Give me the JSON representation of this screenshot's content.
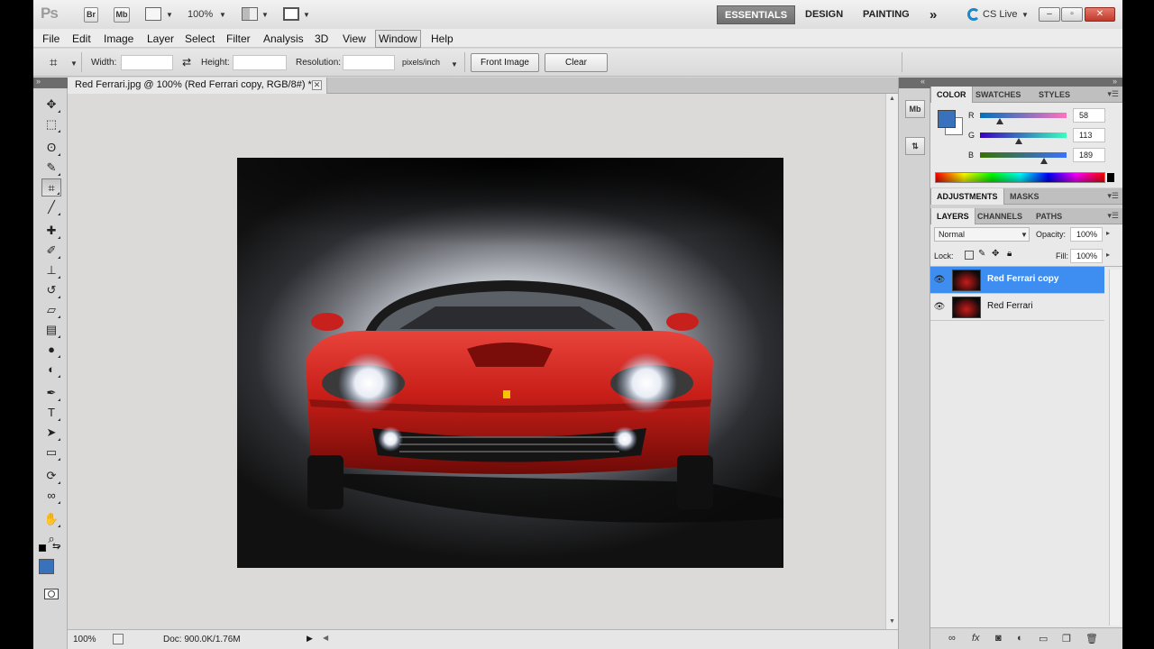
{
  "app": {
    "logo": "Ps",
    "bridge_label": "Br",
    "minibridge_label": "Mb",
    "zoom_value": "100%",
    "workspaces": [
      "ESSENTIALS",
      "DESIGN",
      "PAINTING"
    ],
    "more_workspaces": "»",
    "cslive": "CS Live",
    "window_controls": {
      "minimize": "–",
      "restore": "▫",
      "close": "✕"
    }
  },
  "menu": [
    "File",
    "Edit",
    "Image",
    "Layer",
    "Select",
    "Filter",
    "Analysis",
    "3D",
    "View",
    "Window",
    "Help"
  ],
  "options": {
    "width_label": "Width:",
    "height_label": "Height:",
    "swap_icon": "⇄",
    "resolution_label": "Resolution:",
    "units": "pixels/inch",
    "front_image": "Front Image",
    "clear": "Clear"
  },
  "document": {
    "tab_title": "Red Ferrari.jpg @ 100% (Red Ferrari copy, RGB/8#) *",
    "close": "✕",
    "status_zoom": "100%",
    "status_doc": "Doc: 900.0K/1.76M"
  },
  "tools": [
    {
      "name": "move-tool",
      "glyph": "✥",
      "selected": false
    },
    {
      "name": "marquee-tool",
      "glyph": "⬚",
      "selected": false
    },
    {
      "name": "lasso-tool",
      "glyph": "ʘ",
      "selected": false
    },
    {
      "name": "quick-selection-tool",
      "glyph": "✎",
      "selected": false
    },
    {
      "name": "crop-tool",
      "glyph": "⌗",
      "selected": true
    },
    {
      "name": "eyedropper-tool",
      "glyph": "╱",
      "selected": false
    },
    {
      "name": "healing-brush-tool",
      "glyph": "✚",
      "selected": false
    },
    {
      "name": "brush-tool",
      "glyph": "✐",
      "selected": false
    },
    {
      "name": "clone-stamp-tool",
      "glyph": "⊥",
      "selected": false
    },
    {
      "name": "history-brush-tool",
      "glyph": "↺",
      "selected": false
    },
    {
      "name": "eraser-tool",
      "glyph": "▱",
      "selected": false
    },
    {
      "name": "gradient-tool",
      "glyph": "▤",
      "selected": false
    },
    {
      "name": "blur-tool",
      "glyph": "●",
      "selected": false
    },
    {
      "name": "dodge-tool",
      "glyph": "◐",
      "selected": false
    },
    {
      "name": "pen-tool",
      "glyph": "✒",
      "selected": false
    },
    {
      "name": "type-tool",
      "glyph": "T",
      "selected": false
    },
    {
      "name": "path-selection-tool",
      "glyph": "➤",
      "selected": false
    },
    {
      "name": "shape-tool",
      "glyph": "▭",
      "selected": false
    },
    {
      "name": "3d-rotate-tool",
      "glyph": "⟳",
      "selected": false
    },
    {
      "name": "3d-orbit-tool",
      "glyph": "∞",
      "selected": false
    },
    {
      "name": "hand-tool",
      "glyph": "✋",
      "selected": false
    },
    {
      "name": "zoom-tool",
      "glyph": "⌕",
      "selected": false
    }
  ],
  "color_panel": {
    "tabs": [
      "COLOR",
      "SWATCHES",
      "STYLES"
    ],
    "r_label": "R",
    "g_label": "G",
    "b_label": "B",
    "r": "58",
    "g": "113",
    "b": "189",
    "fg_color": "#3a71bd",
    "r_level": 0.227,
    "g_level": 0.443,
    "b_level": 0.741
  },
  "adjustments_panel": {
    "tabs": [
      "ADJUSTMENTS",
      "MASKS"
    ]
  },
  "layers_panel": {
    "tabs": [
      "LAYERS",
      "CHANNELS",
      "PATHS"
    ],
    "blend_mode": "Normal",
    "opacity_label": "Opacity:",
    "opacity": "100%",
    "lock_label": "Lock:",
    "fill_label": "Fill:",
    "fill": "100%",
    "layers": [
      {
        "name": "Red Ferrari copy",
        "selected": true
      },
      {
        "name": "Red Ferrari",
        "selected": false
      }
    ]
  },
  "colors": {
    "selection_blue": "#3d8ef0",
    "ferrari_red": "#c8201c"
  }
}
